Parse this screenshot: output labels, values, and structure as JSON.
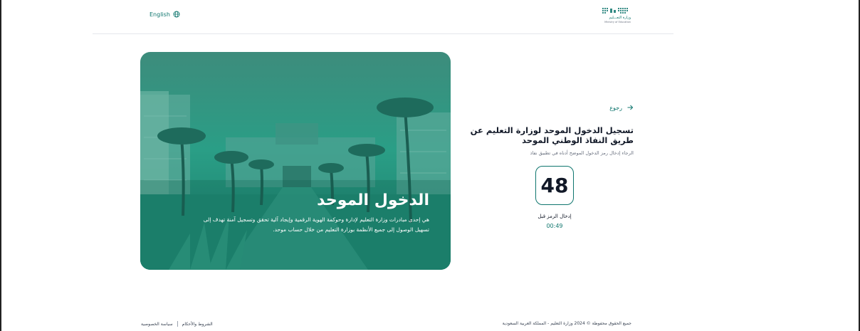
{
  "header": {
    "language_label": "English",
    "logo_name": "وزارة التعـــليم",
    "logo_sub": "Ministry of Education"
  },
  "hero": {
    "title": "الدخول الموحد",
    "description": "هي إحدى مبادرات وزارة التعليم لإدارة وحوكمة الهوية الرقمية وإيجاد آلية تحقق وتسجيل آمنة تهدف إلى تسهيل الوصول إلى جميع الأنظمة بوزارة التعليم من خلال حساب موحد."
  },
  "login": {
    "back_label": "رجوع",
    "title": "تسجيل الدخول الموحد لوزارة التعليم عن طريق النفاذ الوطني الموحد",
    "instruction": "الرجاء إدخال رمز الدخول الموضح أدناه في تطبيق نفاذ",
    "code": "48",
    "timer_label": "إدخال الرمز قبل",
    "timer_value": "00:49"
  },
  "footer": {
    "copyright": "جميع الحقوق محفوظة © 2024 وزارة التعليم - المملكة العربية السعودية",
    "terms_label": "الشروط والأحكام",
    "privacy_label": "سياسة الخصوصية"
  },
  "colors": {
    "accent": "#0f766e",
    "hero_overlay": "#1aa08a"
  },
  "icons": {
    "language": "globe-icon",
    "back": "arrow-right-icon"
  }
}
